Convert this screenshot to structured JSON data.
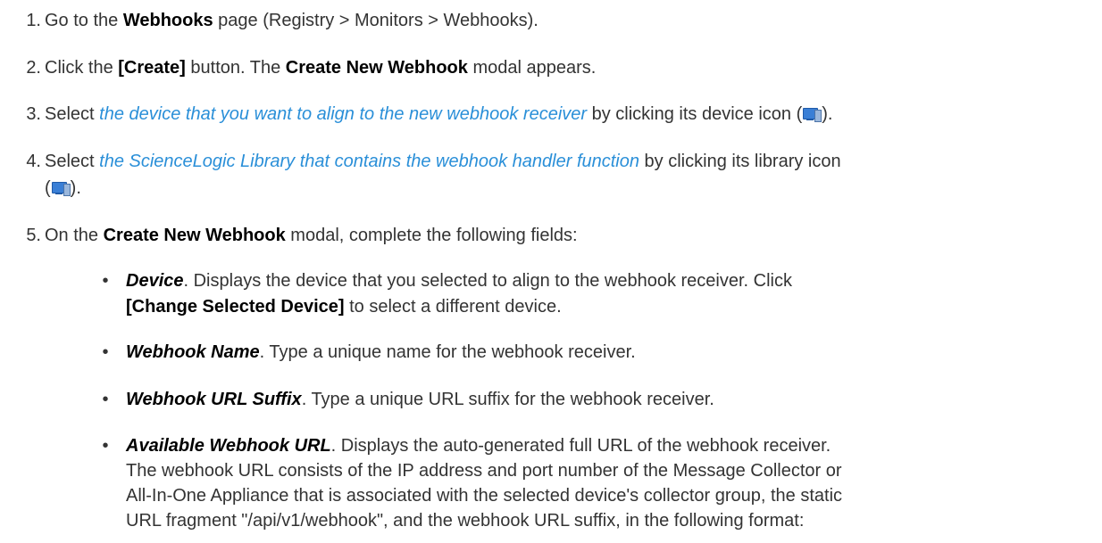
{
  "steps": [
    {
      "number": "1.",
      "prefix": "Go to the ",
      "page_name": "Webhooks",
      "suffix": " page (Registry > Monitors > Webhooks)."
    },
    {
      "number": "2.",
      "prefix": "Click the ",
      "button": "[Create]",
      "middle": " button. The ",
      "modal": "Create New Webhook",
      "suffix": " modal appears."
    },
    {
      "number": "3.",
      "prefix": "Select ",
      "link": "the device that you want to align to the new webhook receiver",
      "middle": " by clicking its device icon (",
      "suffix": ")."
    },
    {
      "number": "4.",
      "prefix": "Select ",
      "link": "the ScienceLogic Library that contains the webhook handler function",
      "middle": " by clicking its library icon",
      "line2_prefix": "(",
      "line2_suffix": ")."
    },
    {
      "number": "5.",
      "prefix": "On the ",
      "modal": "Create New Webhook",
      "suffix": " modal, complete the following fields:"
    }
  ],
  "fields": [
    {
      "bullet": "•",
      "name": "Device",
      "desc_line1": ". Displays the device that you selected to align to the webhook receiver. Click",
      "button": "[Change Selected Device]",
      "desc_line2": " to select a different device."
    },
    {
      "bullet": "•",
      "name": "Webhook Name",
      "desc": ". Type a unique name for the webhook receiver."
    },
    {
      "bullet": "•",
      "name": "Webhook URL Suffix",
      "desc": ". Type a unique URL suffix for the webhook receiver."
    },
    {
      "bullet": "•",
      "name": "Available Webhook URL",
      "desc_line1": ". Displays the auto-generated full URL of the webhook receiver.",
      "lines": [
        "The webhook URL consists of the IP address and port number of the Message Collector or",
        "All-In-One Appliance that is associated with the selected device's collector group, the static",
        "URL fragment \"/api/v1/webhook\", and the webhook URL suffix, in the following format:"
      ]
    }
  ],
  "icons": {
    "device_icon": "device-icon",
    "library_icon": "library-icon"
  },
  "colors": {
    "text": "#333333",
    "bold": "#000000",
    "link": "#2a8fd8",
    "icon": "#3a7fd6"
  }
}
